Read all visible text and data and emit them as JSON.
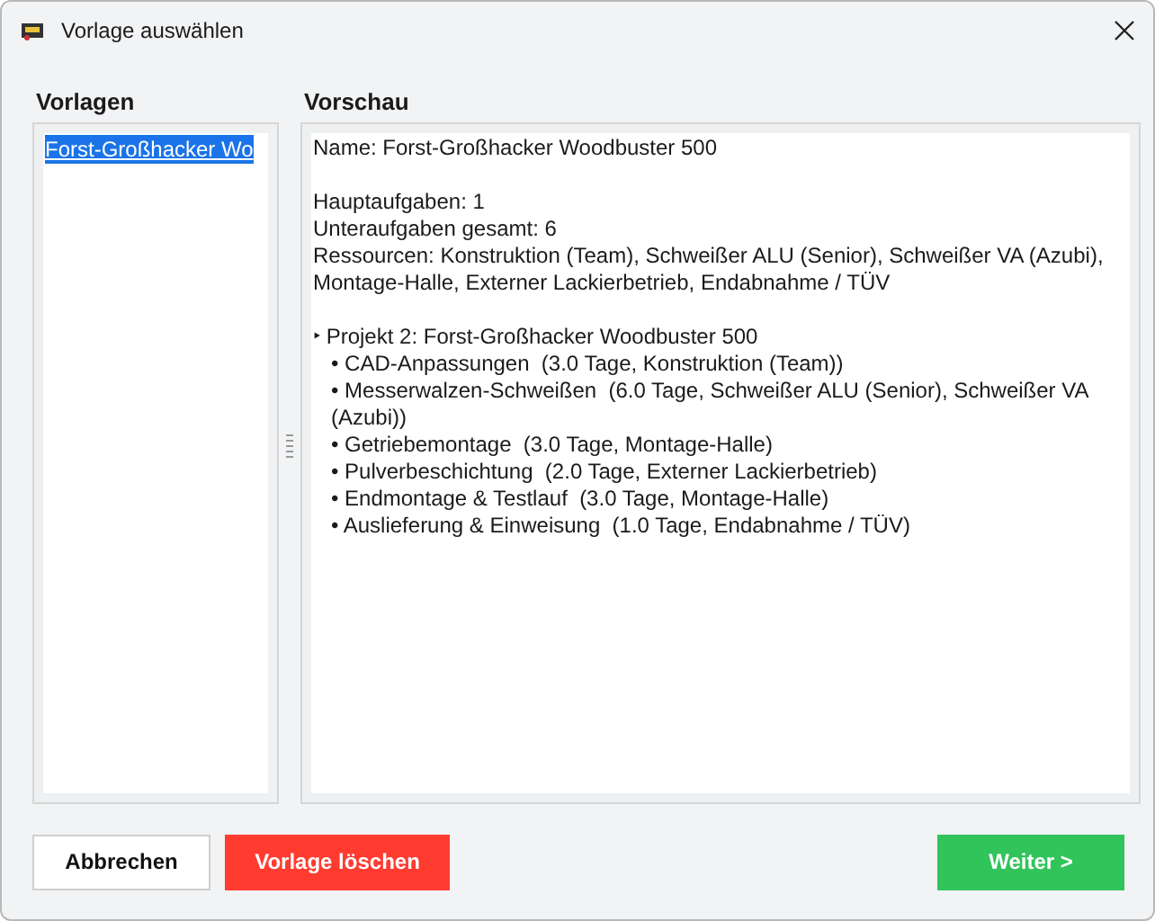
{
  "window": {
    "title": "Vorlage auswählen"
  },
  "templates": {
    "heading": "Vorlagen",
    "items": [
      {
        "label": "Forst-Großhacker Wo",
        "selected": true
      }
    ]
  },
  "preview": {
    "heading": "Vorschau",
    "blocks": [
      [
        "Name: Forst-Großhacker Woodbuster 500"
      ],
      [
        "Hauptaufgaben: 1",
        "Unteraufgaben gesamt: 6",
        "Ressourcen: Konstruktion (Team), Schweißer ALU (Senior), Schweißer VA (Azubi), Montage-Halle, Externer Lackierbetrieb, Endabnahme / TÜV"
      ]
    ],
    "tree": [
      {
        "text": "‣ Projekt 2: Forst-Großhacker Woodbuster 500",
        "children": [
          {
            "text": "• CAD-Anpassungen  (3.0 Tage, Konstruktion (Team))"
          },
          {
            "text": "• Messerwalzen-Schweißen  (6.0 Tage, Schweißer ALU (Senior), Schweißer VA (Azubi))"
          },
          {
            "text": "• Getriebemontage  (3.0 Tage, Montage-Halle)"
          },
          {
            "text": "• Pulverbeschichtung  (2.0 Tage, Externer Lackierbetrieb)"
          },
          {
            "text": "• Endmontage & Testlauf  (3.0 Tage, Montage-Halle)"
          },
          {
            "text": "• Auslieferung & Einweisung  (1.0 Tage, Endabnahme / TÜV)"
          }
        ]
      }
    ]
  },
  "buttons": [
    {
      "kind": "cancel",
      "label": "Abbrechen"
    },
    {
      "kind": "delete",
      "label": "Vorlage löschen"
    },
    {
      "kind": "next",
      "label": "Weiter >"
    }
  ]
}
